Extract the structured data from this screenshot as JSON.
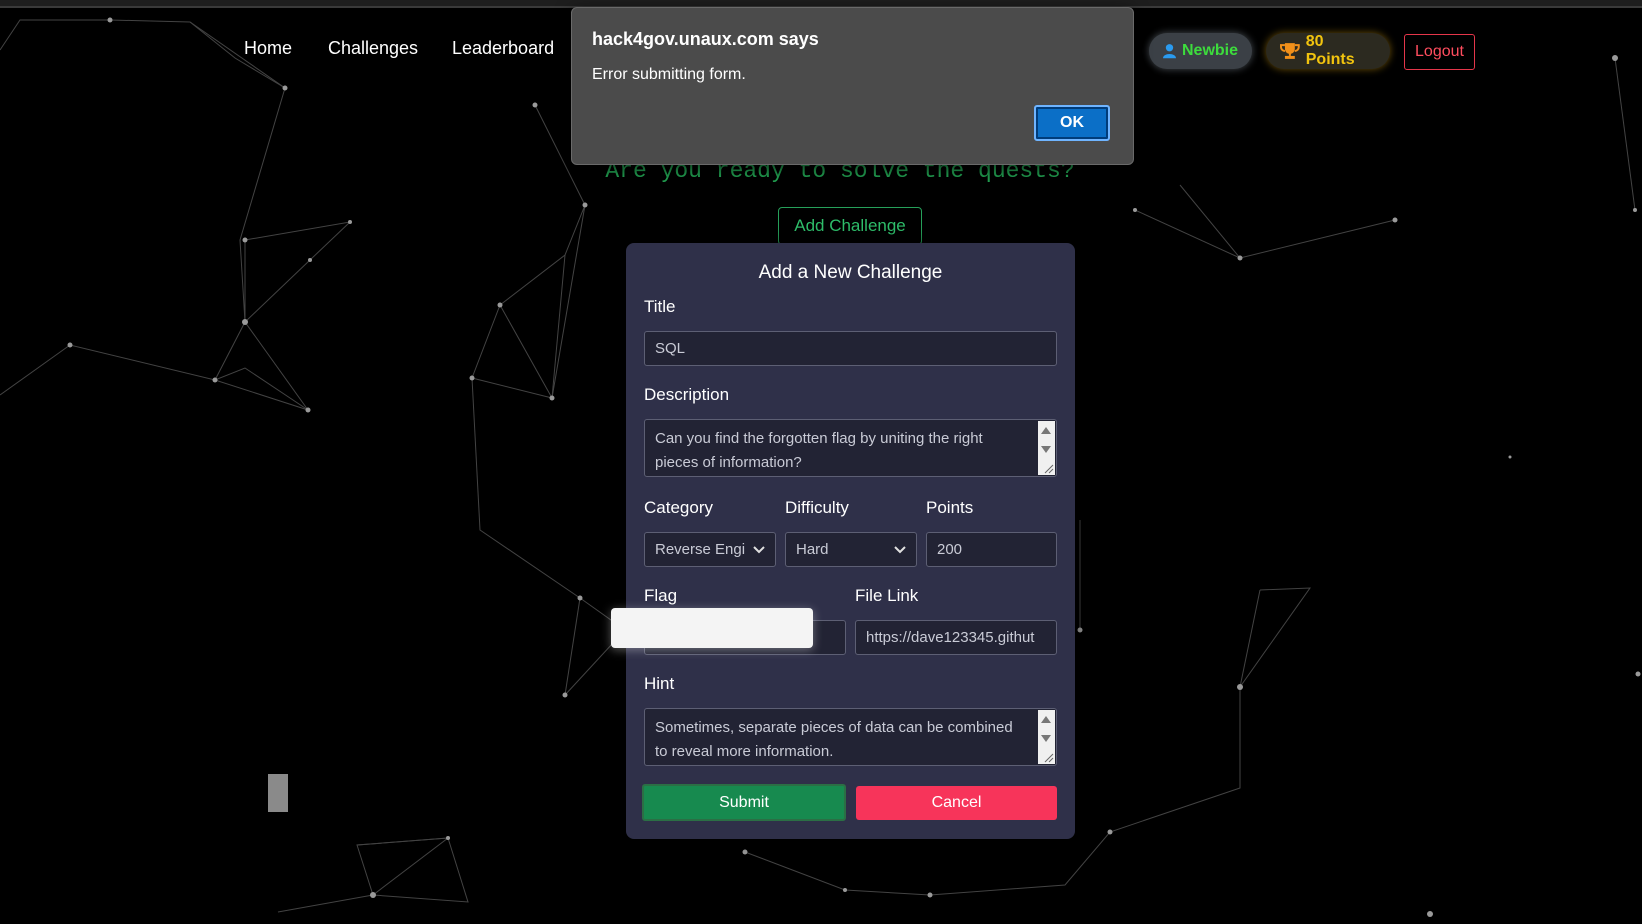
{
  "nav": {
    "links": [
      "Home",
      "Challenges",
      "Leaderboard"
    ],
    "rank_label": "Newbie",
    "points_label": "80 Points",
    "logout_label": "Logout"
  },
  "hero": {
    "tagline": "Are you ready to solve the quests?",
    "add_button": "Add Challenge"
  },
  "modal": {
    "title": "Add a New Challenge",
    "title_label": "Title",
    "title_value": "SQL",
    "description_label": "Description",
    "description_value": "Can you find the forgotten flag by uniting the right pieces of information?",
    "category_label": "Category",
    "category_value": "Reverse Engi",
    "difficulty_label": "Difficulty",
    "difficulty_value": "Hard",
    "points_label": "Points",
    "points_value": "200",
    "flag_label": "Flag",
    "file_link_label": "File Link",
    "file_link_value": "https://dave123345.githut",
    "hint_label": "Hint",
    "hint_value": "Sometimes, separate pieces of data can be combined to reveal more information.",
    "submit_label": "Submit",
    "cancel_label": "Cancel"
  },
  "alert": {
    "title": "hack4gov.unaux.com says",
    "message": "Error submitting form.",
    "ok_label": "OK"
  },
  "colors": {
    "accent_green": "#22a352",
    "rank_green": "#3ddc3d",
    "points_gold": "#f2c40e",
    "danger_red": "#f7345a",
    "dialog_blue": "#0b6fc7"
  }
}
